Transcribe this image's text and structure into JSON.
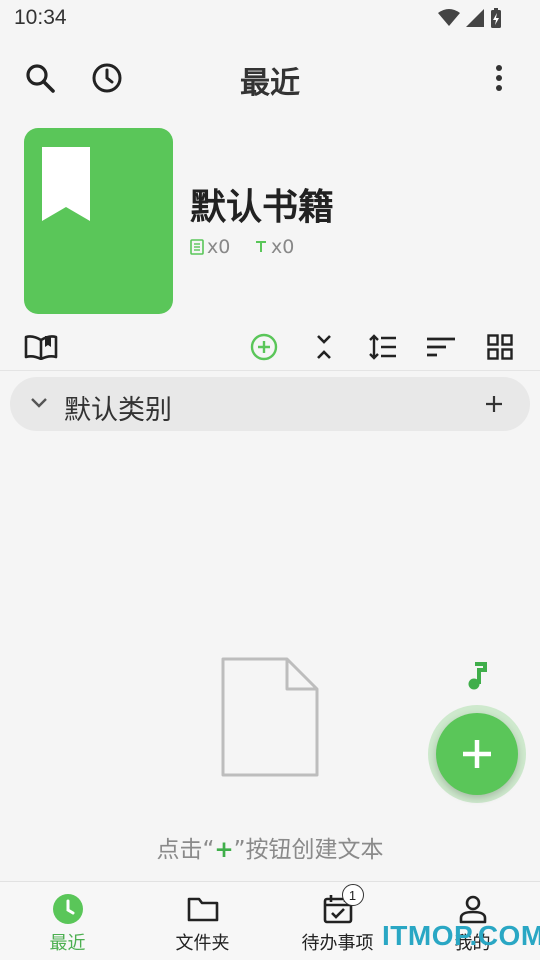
{
  "status_bar": {
    "time": "10:34"
  },
  "header": {
    "title": "最近"
  },
  "book": {
    "title": "默认书籍",
    "doc_count": "x0",
    "text_count": "x0"
  },
  "category": {
    "label": "默认类别"
  },
  "empty_state": {
    "hint_before": "点击“",
    "hint_plus": "+",
    "hint_after": "”按钮创建文本"
  },
  "bottom_nav": {
    "items": [
      {
        "label": "最近",
        "icon": "clock-icon",
        "active": true
      },
      {
        "label": "文件夹",
        "icon": "folder-icon"
      },
      {
        "label": "待办事项",
        "icon": "calendar-check-icon",
        "badge": "1"
      },
      {
        "label": "我的",
        "icon": "person-icon"
      }
    ]
  },
  "watermark": "ITMOP.COM",
  "colors": {
    "accent": "#5ac659",
    "background": "#f5f5f5",
    "category_bg": "#e8e8e8"
  }
}
